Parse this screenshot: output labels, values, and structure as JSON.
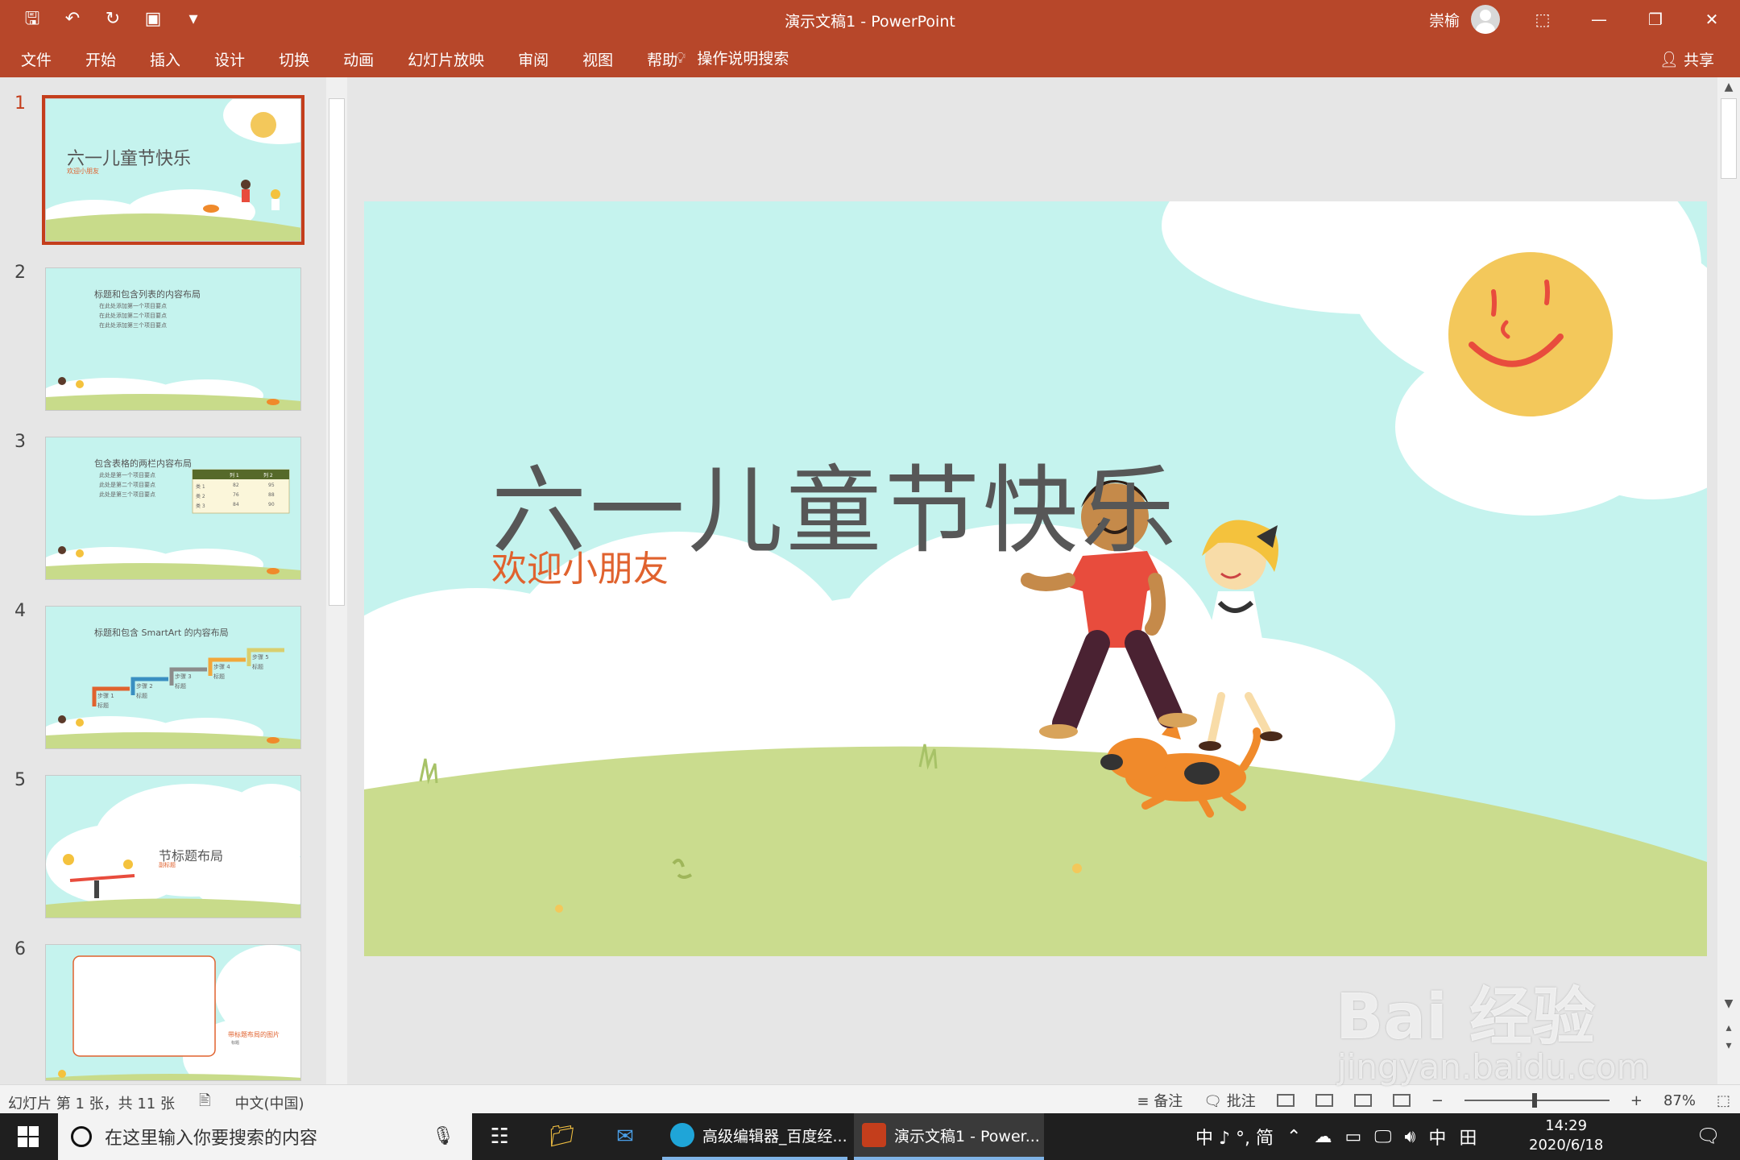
{
  "window": {
    "title": "演示文稿1  -  PowerPoint",
    "user_name": "崇榆",
    "accent_color": "#b7472a"
  },
  "qat": {
    "save_icon": "save-icon",
    "undo_icon": "undo-icon",
    "redo_icon": "redo-icon",
    "present_icon": "present-from-start-icon",
    "customize_icon": "chevron-down-icon"
  },
  "ribbon": {
    "tabs": [
      "文件",
      "开始",
      "插入",
      "设计",
      "切换",
      "动画",
      "幻灯片放映",
      "审阅",
      "视图",
      "帮助"
    ],
    "tell_me": "操作说明搜索",
    "share": "共享"
  },
  "thumbnails": [
    {
      "num": "1",
      "title": "六一儿童节快乐",
      "subtitle": "欢迎小朋友"
    },
    {
      "num": "2",
      "title": "标题和包含列表的内容布局",
      "bullets": [
        "在此处添加第一个项目要点",
        "在此处添加第二个项目要点",
        "在此处添加第三个项目要点"
      ]
    },
    {
      "num": "3",
      "title": "包含表格的两栏内容布局",
      "bullets": [
        "此处是第一个项目要点",
        "此处是第二个项目要点",
        "此处是第三个项目要点"
      ],
      "table": {
        "headers": [
          "",
          "列 1",
          "列 2"
        ],
        "rows": [
          [
            "类 1",
            "82",
            "95"
          ],
          [
            "类 2",
            "76",
            "88"
          ],
          [
            "类 3",
            "84",
            "90"
          ]
        ]
      }
    },
    {
      "num": "4",
      "title": "标题和包含 SmartArt 的内容布局",
      "steps": [
        "步骤 1",
        "步骤 2",
        "步骤 3",
        "步骤 4",
        "步骤 5"
      ],
      "step_label": "标题"
    },
    {
      "num": "5",
      "title": "节标题布局",
      "subtitle": "副标题"
    },
    {
      "num": "6",
      "title": "带标题布局的图片",
      "subtitle": "标题"
    }
  ],
  "slide": {
    "title": "六一儿童节快乐",
    "subtitle": "欢迎小朋友"
  },
  "status": {
    "slide_info": "幻灯片 第 1 张，共 11 张",
    "language": "中文(中国)",
    "notes": "备注",
    "comments": "批注",
    "zoom": "87%"
  },
  "taskbar": {
    "search_placeholder": "在这里输入你要搜索的内容",
    "edge_label": "高级编辑器_百度经...",
    "ppt_label": "演示文稿1 - Power...",
    "ime": "中 ♪ °, 简",
    "lang": "中",
    "time": "14:29",
    "date": "2020/6/18"
  },
  "watermark": {
    "brand": "Bai 经验",
    "url": "jingyan.baidu.com"
  }
}
